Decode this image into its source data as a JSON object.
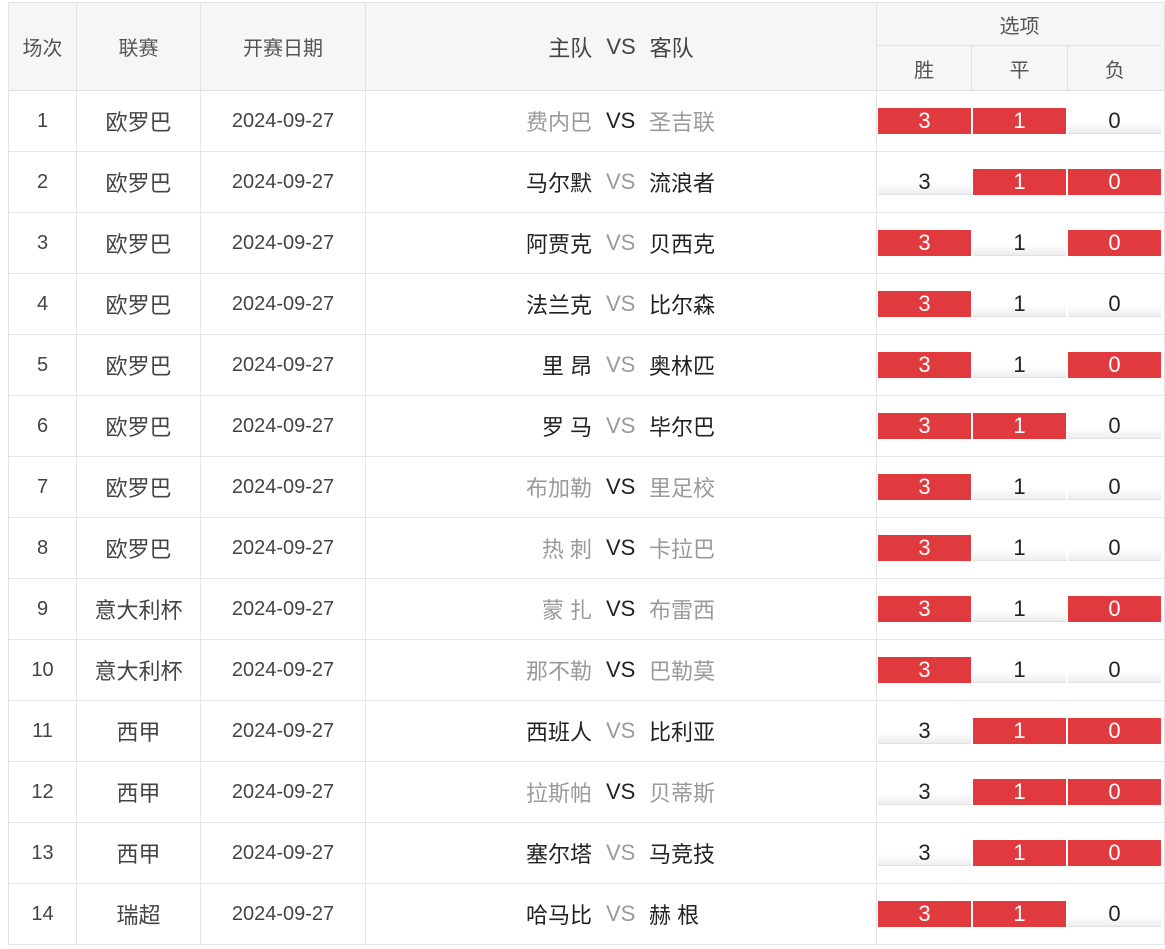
{
  "header": {
    "seq": "场次",
    "league": "联赛",
    "date": "开赛日期",
    "home": "主队",
    "vs": "VS",
    "away": "客队",
    "options_title": "选项",
    "win": "胜",
    "draw": "平",
    "lose": "负"
  },
  "colors": {
    "selected_bg": "#e03a3e",
    "selected_text": "#ffffff",
    "header_bg": "#f6f6f6"
  },
  "rows": [
    {
      "seq": "1",
      "league": "欧罗巴",
      "date": "2024-09-27",
      "home": "费内巴",
      "vs": "VS",
      "away": "圣吉联",
      "home_grey": true,
      "vs_grey": false,
      "away_grey": true,
      "win": "3",
      "draw": "1",
      "lose": "0",
      "win_sel": true,
      "draw_sel": true,
      "lose_sel": false
    },
    {
      "seq": "2",
      "league": "欧罗巴",
      "date": "2024-09-27",
      "home": "马尔默",
      "vs": "VS",
      "away": "流浪者",
      "home_grey": false,
      "vs_grey": true,
      "away_grey": false,
      "win": "3",
      "draw": "1",
      "lose": "0",
      "win_sel": false,
      "draw_sel": true,
      "lose_sel": true
    },
    {
      "seq": "3",
      "league": "欧罗巴",
      "date": "2024-09-27",
      "home": "阿贾克",
      "vs": "VS",
      "away": "贝西克",
      "home_grey": false,
      "vs_grey": true,
      "away_grey": false,
      "win": "3",
      "draw": "1",
      "lose": "0",
      "win_sel": true,
      "draw_sel": false,
      "lose_sel": true
    },
    {
      "seq": "4",
      "league": "欧罗巴",
      "date": "2024-09-27",
      "home": "法兰克",
      "vs": "VS",
      "away": "比尔森",
      "home_grey": false,
      "vs_grey": true,
      "away_grey": false,
      "win": "3",
      "draw": "1",
      "lose": "0",
      "win_sel": true,
      "draw_sel": false,
      "lose_sel": false
    },
    {
      "seq": "5",
      "league": "欧罗巴",
      "date": "2024-09-27",
      "home": "里 昂",
      "vs": "VS",
      "away": "奥林匹",
      "home_grey": false,
      "vs_grey": true,
      "away_grey": false,
      "win": "3",
      "draw": "1",
      "lose": "0",
      "win_sel": true,
      "draw_sel": false,
      "lose_sel": true
    },
    {
      "seq": "6",
      "league": "欧罗巴",
      "date": "2024-09-27",
      "home": "罗 马",
      "vs": "VS",
      "away": "毕尔巴",
      "home_grey": false,
      "vs_grey": true,
      "away_grey": false,
      "win": "3",
      "draw": "1",
      "lose": "0",
      "win_sel": true,
      "draw_sel": true,
      "lose_sel": false
    },
    {
      "seq": "7",
      "league": "欧罗巴",
      "date": "2024-09-27",
      "home": "布加勒",
      "vs": "VS",
      "away": "里足校",
      "home_grey": true,
      "vs_grey": false,
      "away_grey": true,
      "win": "3",
      "draw": "1",
      "lose": "0",
      "win_sel": true,
      "draw_sel": false,
      "lose_sel": false
    },
    {
      "seq": "8",
      "league": "欧罗巴",
      "date": "2024-09-27",
      "home": "热 刺",
      "vs": "VS",
      "away": "卡拉巴",
      "home_grey": true,
      "vs_grey": false,
      "away_grey": true,
      "win": "3",
      "draw": "1",
      "lose": "0",
      "win_sel": true,
      "draw_sel": false,
      "lose_sel": false
    },
    {
      "seq": "9",
      "league": "意大利杯",
      "date": "2024-09-27",
      "home": "蒙 扎",
      "vs": "VS",
      "away": "布雷西",
      "home_grey": true,
      "vs_grey": false,
      "away_grey": true,
      "win": "3",
      "draw": "1",
      "lose": "0",
      "win_sel": true,
      "draw_sel": false,
      "lose_sel": true
    },
    {
      "seq": "10",
      "league": "意大利杯",
      "date": "2024-09-27",
      "home": "那不勒",
      "vs": "VS",
      "away": "巴勒莫",
      "home_grey": true,
      "vs_grey": false,
      "away_grey": true,
      "win": "3",
      "draw": "1",
      "lose": "0",
      "win_sel": true,
      "draw_sel": false,
      "lose_sel": false
    },
    {
      "seq": "11",
      "league": "西甲",
      "date": "2024-09-27",
      "home": "西班人",
      "vs": "VS",
      "away": "比利亚",
      "home_grey": false,
      "vs_grey": true,
      "away_grey": false,
      "win": "3",
      "draw": "1",
      "lose": "0",
      "win_sel": false,
      "draw_sel": true,
      "lose_sel": true
    },
    {
      "seq": "12",
      "league": "西甲",
      "date": "2024-09-27",
      "home": "拉斯帕",
      "vs": "VS",
      "away": "贝蒂斯",
      "home_grey": true,
      "vs_grey": false,
      "away_grey": true,
      "win": "3",
      "draw": "1",
      "lose": "0",
      "win_sel": false,
      "draw_sel": true,
      "lose_sel": true
    },
    {
      "seq": "13",
      "league": "西甲",
      "date": "2024-09-27",
      "home": "塞尔塔",
      "vs": "VS",
      "away": "马竞技",
      "home_grey": false,
      "vs_grey": true,
      "away_grey": false,
      "win": "3",
      "draw": "1",
      "lose": "0",
      "win_sel": false,
      "draw_sel": true,
      "lose_sel": true
    },
    {
      "seq": "14",
      "league": "瑞超",
      "date": "2024-09-27",
      "home": "哈马比",
      "vs": "VS",
      "away": "赫 根",
      "home_grey": false,
      "vs_grey": true,
      "away_grey": false,
      "win": "3",
      "draw": "1",
      "lose": "0",
      "win_sel": true,
      "draw_sel": true,
      "lose_sel": false
    }
  ]
}
